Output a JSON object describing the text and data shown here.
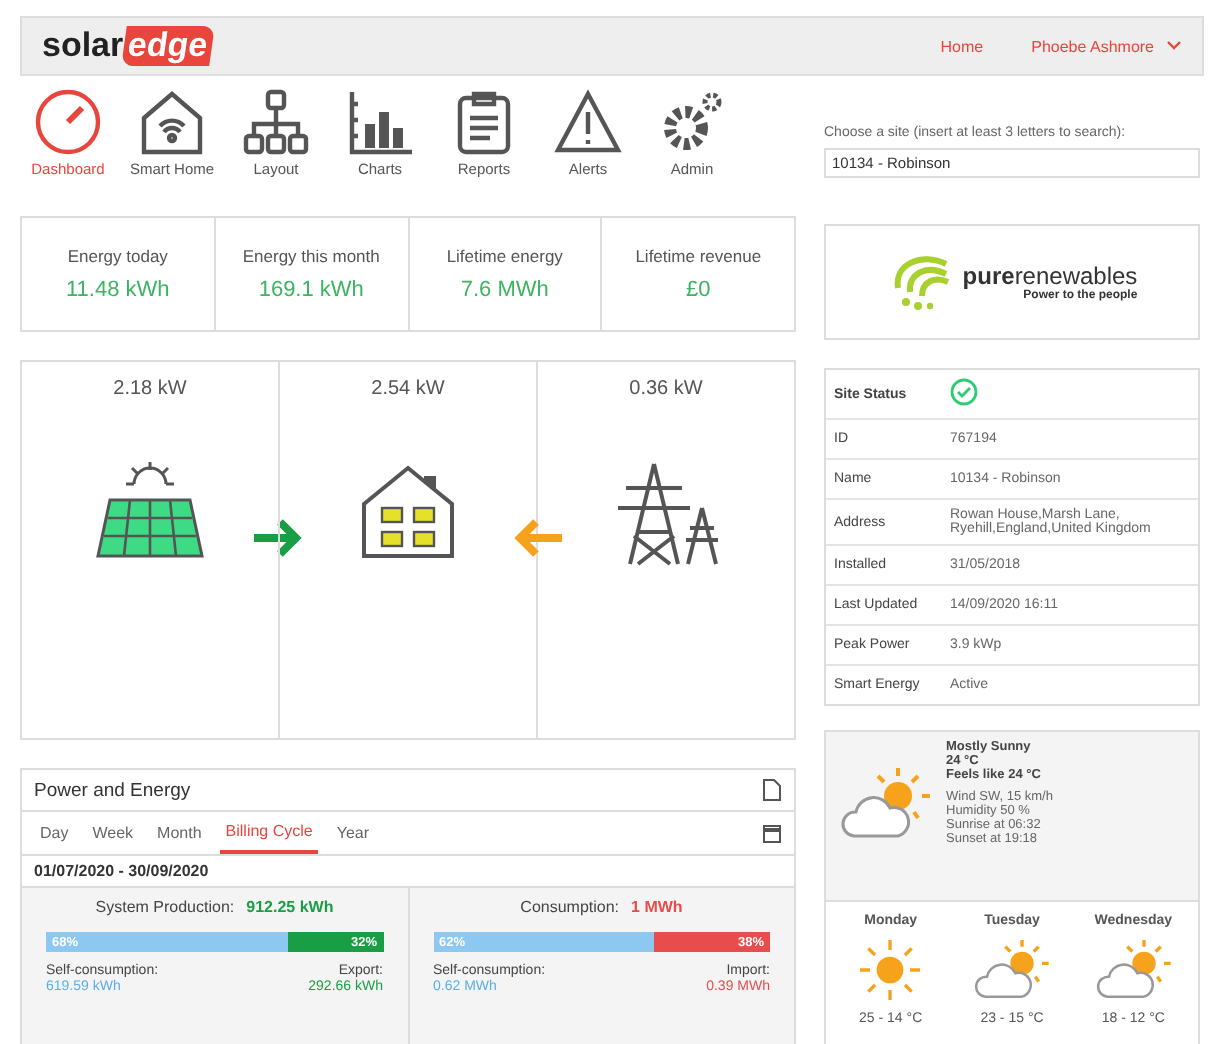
{
  "header": {
    "logo_left": "solar",
    "logo_right": "edge",
    "links": [
      "Home",
      "Phoebe Ashmore"
    ]
  },
  "nav": [
    {
      "label": "Dashboard",
      "kind": "dashboard",
      "selected": true
    },
    {
      "label": "Smart Home",
      "kind": "smarthome",
      "selected": false
    },
    {
      "label": "Layout",
      "kind": "layout",
      "selected": false
    },
    {
      "label": "Charts",
      "kind": "charts",
      "selected": false
    },
    {
      "label": "Reports",
      "kind": "reports",
      "selected": false
    },
    {
      "label": "Alerts",
      "kind": "alerts",
      "selected": false
    },
    {
      "label": "Admin",
      "kind": "admin",
      "selected": false
    }
  ],
  "site_chooser": {
    "label": "Choose a site (insert at least 3 letters to search):",
    "value": "10134 - Robinson"
  },
  "kpis": [
    {
      "label": "Energy today",
      "value": "11.48 kWh"
    },
    {
      "label": "Energy this month",
      "value": "169.1 kWh"
    },
    {
      "label": "Lifetime energy",
      "value": "7.6 MWh"
    },
    {
      "label": "Lifetime revenue",
      "value": "£0"
    }
  ],
  "installer_logo": {
    "name_bold": "pure",
    "name": "renewables",
    "tagline": "Power to the people"
  },
  "flow": [
    {
      "kind": "solar",
      "value": "2.18 kW"
    },
    {
      "kind": "home",
      "value": "2.54 kW"
    },
    {
      "kind": "grid",
      "value": "0.36 kW"
    }
  ],
  "site_details": [
    {
      "label": "Site Status",
      "kind": "status",
      "ok": true
    },
    {
      "label": "ID",
      "value": "767194"
    },
    {
      "label": "Name",
      "value": "10134 - Robinson"
    },
    {
      "label": "Address",
      "value": "Rowan House,Marsh Lane, Ryehill,England,United Kingdom"
    },
    {
      "label": "Installed",
      "value": "31/05/2018"
    },
    {
      "label": "Last Updated",
      "value": "14/09/2020 16:11"
    },
    {
      "label": "Peak Power",
      "value": "3.9 kWp"
    },
    {
      "label": "Smart Energy",
      "value": "Active"
    }
  ],
  "power_energy": {
    "title": "Power and Energy",
    "tabs": [
      {
        "label": "Day",
        "selected": false
      },
      {
        "label": "Week",
        "selected": false
      },
      {
        "label": "Month",
        "selected": false
      },
      {
        "label": "Billing Cycle",
        "selected": true
      },
      {
        "label": "Year",
        "selected": false
      }
    ],
    "period": "01/07/2020 - 30/09/2020",
    "panels": [
      {
        "label": "System Production:",
        "total": "912.25 kWh",
        "color": "#1a9e45",
        "level": 0.68,
        "left_pct": "68%",
        "right_pct": "32%",
        "left_label": "Self-consumption:",
        "left_value": "619.59 kWh",
        "right_label": "Export:",
        "right_value": "292.66 kWh"
      },
      {
        "label": "Consumption:",
        "total": "1 MWh",
        "color": "#e84c4c",
        "level": 0.62,
        "left_pct": "62%",
        "right_pct": "38%",
        "left_label": "Self-consumption:",
        "left_value": "0.62 MWh",
        "right_label": "Import:",
        "right_value": "0.39 MWh"
      }
    ]
  },
  "weather": {
    "kind": "partly-cloudy",
    "condition": "Mostly Sunny",
    "temp": "24 °C",
    "feels": "Feels like 24 °C",
    "details": [
      "Wind SW, 15 km/h",
      "Humidity 50 %",
      "Sunrise at 06:32",
      "Sunset at 19:18"
    ],
    "forecast": [
      {
        "day": "Monday",
        "kind": "sunny",
        "range": "25 - 14 °C"
      },
      {
        "day": "Tuesday",
        "kind": "partly-cloudy",
        "range": "23 - 15 °C"
      },
      {
        "day": "Wednesday",
        "kind": "partly-cloudy",
        "range": "18 - 12 °C"
      }
    ]
  }
}
